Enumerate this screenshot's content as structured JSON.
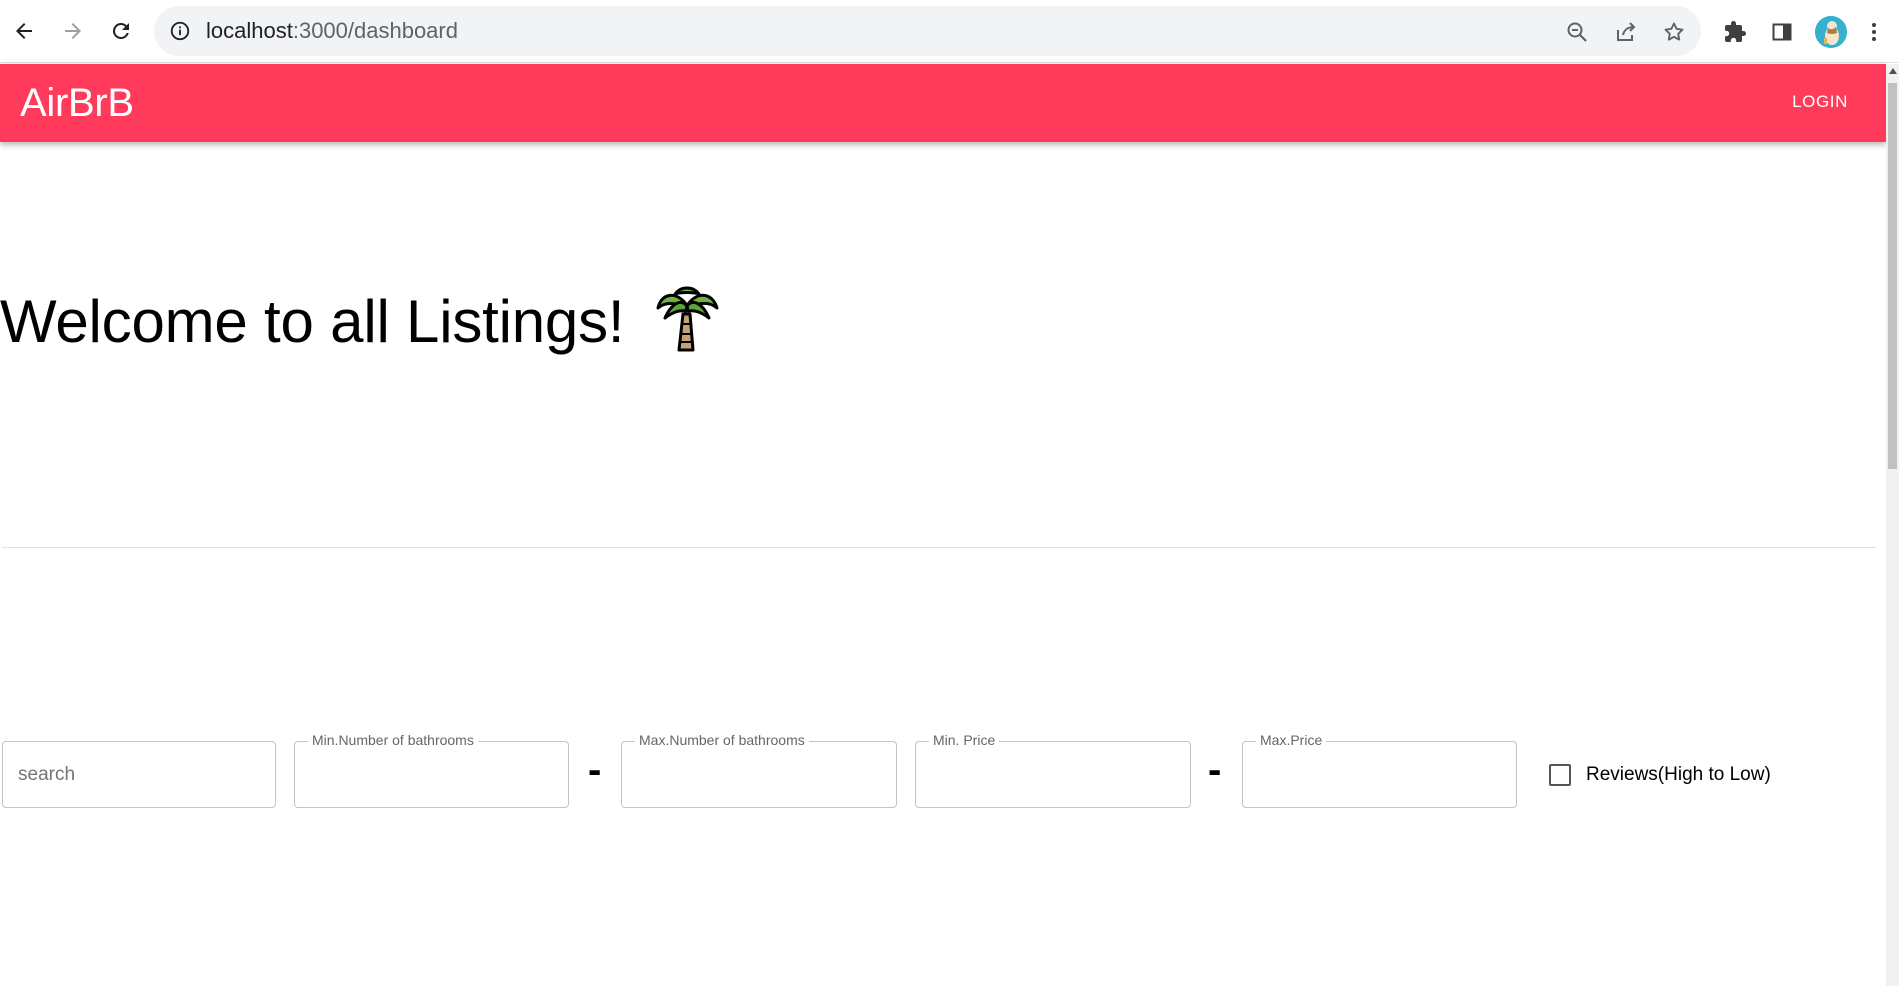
{
  "browser": {
    "url_host": "localhost",
    "url_path": ":3000/dashboard"
  },
  "app": {
    "brand": "AirBrB",
    "login_label": "LOGIN",
    "accent_color": "#ff3a5a"
  },
  "main": {
    "welcome_text": "Welcome to all Listings!",
    "welcome_icon": "palm-tree-icon"
  },
  "filters": {
    "search_placeholder": "search",
    "min_bathrooms_label": "Min.Number of bathrooms",
    "max_bathrooms_label": "Max.Number of bathrooms",
    "range_separator": "-",
    "min_price_label": "Min. Price",
    "max_price_label": "Max.Price",
    "reviews_sort_label": "Reviews(High to Low)"
  }
}
